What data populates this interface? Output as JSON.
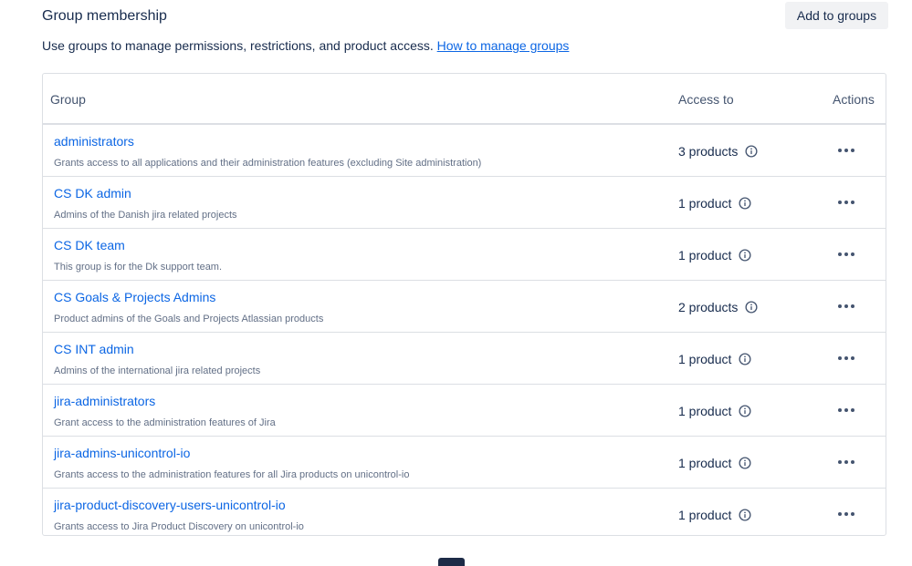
{
  "section": {
    "title": "Group membership",
    "add_button_label": "Add to groups",
    "description_text": "Use groups to manage permissions, restrictions, and product access.",
    "description_link": "How to manage groups"
  },
  "table": {
    "columns": {
      "group": "Group",
      "access": "Access to",
      "actions": "Actions"
    },
    "rows": [
      {
        "name": "administrators",
        "description": "Grants access to all applications and their administration features (excluding Site administration)",
        "access": "3 products"
      },
      {
        "name": "CS DK admin",
        "description": "Admins of the Danish jira related projects",
        "access": "1 product"
      },
      {
        "name": "CS DK team",
        "description": "This group is for the Dk support team.",
        "access": "1 product"
      },
      {
        "name": "CS Goals & Projects Admins",
        "description": "Product admins of the Goals and Projects Atlassian products",
        "access": "2 products"
      },
      {
        "name": "CS INT admin",
        "description": "Admins of the international jira related projects",
        "access": "1 product"
      },
      {
        "name": "jira-administrators",
        "description": "Grant access to the administration features of Jira",
        "access": "1 product"
      },
      {
        "name": "jira-admins-unicontrol-io",
        "description": "Grants access to the administration features for all Jira products on unicontrol-io",
        "access": "1 product"
      },
      {
        "name": "jira-product-discovery-users-unicontrol-io",
        "description": "Grants access to Jira Product Discovery on unicontrol-io",
        "access": "1 product"
      }
    ]
  },
  "icons": {
    "access_info": "info-icon",
    "row_actions": "more-horizontal-icon"
  },
  "colors": {
    "link": "#0c66e4",
    "text": "#172b4d",
    "subtle_text": "#626f86",
    "border": "#dcdfe4",
    "button_bg": "#f1f2f4"
  }
}
